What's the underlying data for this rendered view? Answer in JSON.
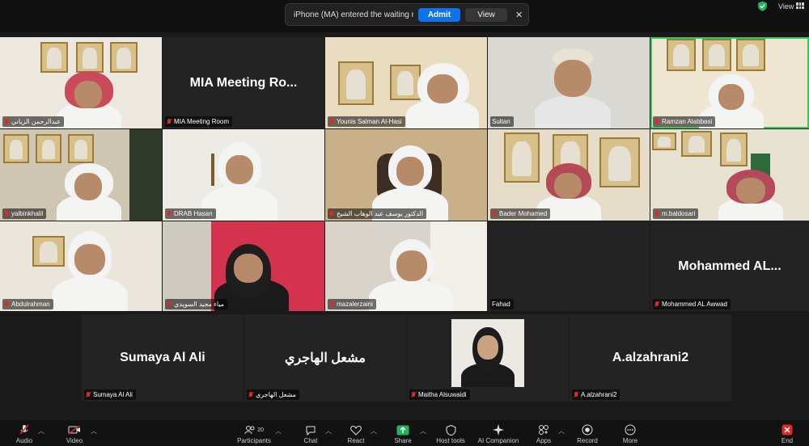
{
  "notification": {
    "message": "iPhone (MA) entered the waiting room",
    "admit": "Admit",
    "view": "View",
    "close": "✕"
  },
  "top_right": {
    "view_label": "View"
  },
  "tiles": {
    "t1": {
      "name": "عبدالرحمن الزياني"
    },
    "t2": {
      "name": "MIA Meeting Room",
      "big": "MIA Meeting Ro..."
    },
    "t3": {
      "name": "Younis Salman Al-Hasi"
    },
    "t4": {
      "name": "Sultan"
    },
    "t5": {
      "name": "Ramzan Alabbasi"
    },
    "t6": {
      "name": "yalbinkhalil"
    },
    "t7": {
      "name": "DRAB Hasan"
    },
    "t8": {
      "name": "الدكتور يوسف عبد الوهاب الشيخ"
    },
    "t9": {
      "name": "Bader Mohamed"
    },
    "t10": {
      "name": "m.baldosari"
    },
    "t11": {
      "name": "Abdulrahman"
    },
    "t12": {
      "name": "مياء مجيد السويدي"
    },
    "t13": {
      "name": "mazalerzaini"
    },
    "t14": {
      "name": "Fahad"
    },
    "t15": {
      "name": "Mohammed AL Awwad",
      "big": "Mohammed  AL..."
    },
    "b1": {
      "name": "Sumaya Al Ali",
      "big": "Sumaya Al Ali"
    },
    "b2": {
      "name": "مشعل الهاجري",
      "big": "مشعل الهاجري"
    },
    "b3": {
      "name": "Maitha Alsuwaidi"
    },
    "b4": {
      "name": "A.alzahrani2",
      "big": "A.alzahrani2"
    }
  },
  "toolbar": {
    "audio": "Audio",
    "video": "Video",
    "participants": "Participants",
    "participants_count": "20",
    "chat": "Chat",
    "react": "React",
    "share": "Share",
    "host_tools": "Host tools",
    "ai_companion": "AI Companion",
    "apps": "Apps",
    "record": "Record",
    "more": "More",
    "end": "End"
  },
  "colors": {
    "accent": "#0e72ed",
    "active_speaker": "#39c55d",
    "muted": "#e02828",
    "share": "#24b35c",
    "end": "#e02828"
  }
}
